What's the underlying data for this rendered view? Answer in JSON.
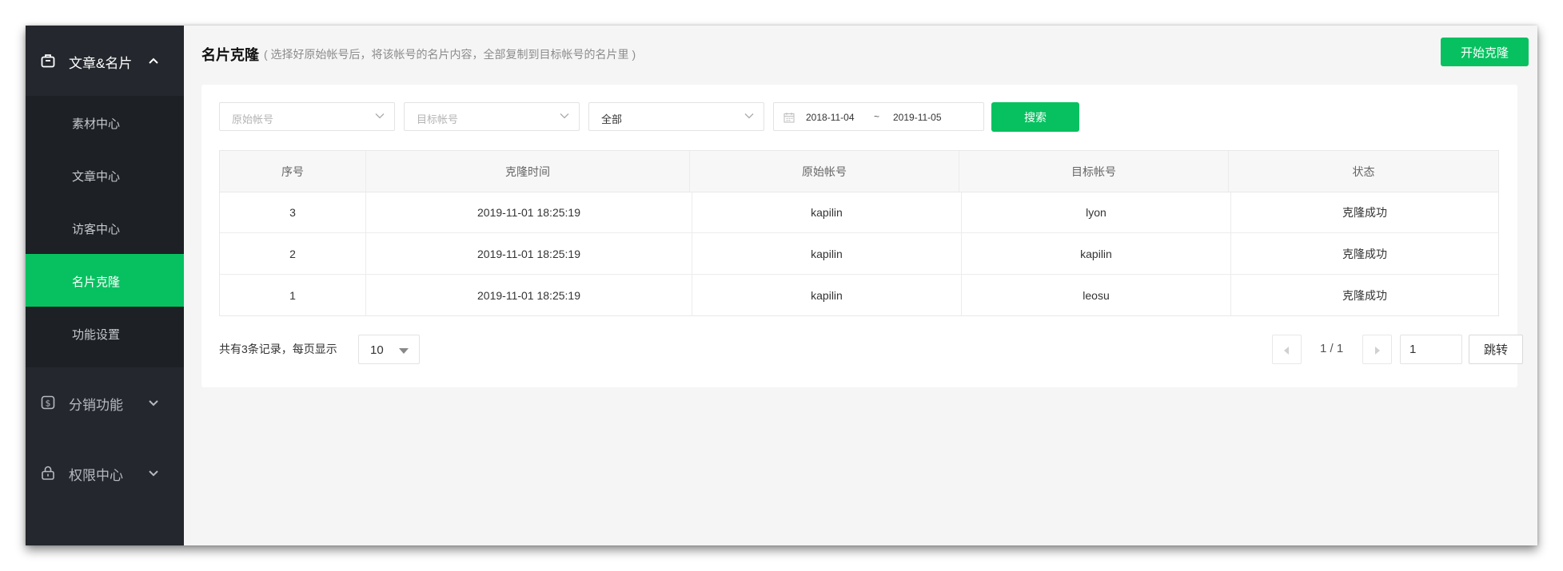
{
  "sidebar": {
    "groups": [
      {
        "label": "文章&名片",
        "icon": "briefcase-icon",
        "expanded": true
      },
      {
        "label": "分销功能",
        "icon": "dollar-icon",
        "expanded": false
      },
      {
        "label": "权限中心",
        "icon": "lock-icon",
        "expanded": false
      }
    ],
    "items": [
      {
        "label": "素材中心"
      },
      {
        "label": "文章中心"
      },
      {
        "label": "访客中心"
      },
      {
        "label": "名片克隆",
        "active": true
      },
      {
        "label": "功能设置"
      }
    ]
  },
  "header": {
    "title": "名片克隆",
    "hint": "( 选择好原始帐号后，将该帐号的名片内容，全部复制到目标帐号的名片里 )",
    "start_button": "开始克隆"
  },
  "filters": {
    "source_placeholder": "原始帐号",
    "target_placeholder": "目标帐号",
    "status_value": "全部",
    "date_start": "2018-11-04",
    "date_sep": "~",
    "date_end": "2019-11-05",
    "search_button": "搜索"
  },
  "table": {
    "headers": [
      "序号",
      "克隆时间",
      "原始帐号",
      "目标帐号",
      "状态"
    ],
    "rows": [
      [
        "3",
        "2019-11-01 18:25:19",
        "kapilin",
        "lyon",
        "克隆成功"
      ],
      [
        "2",
        "2019-11-01 18:25:19",
        "kapilin",
        "kapilin",
        "克隆成功"
      ],
      [
        "1",
        "2019-11-01 18:25:19",
        "kapilin",
        "leosu",
        "克隆成功"
      ]
    ]
  },
  "pagination": {
    "total_text": "共有3条记录，每页显示",
    "page_size": "10",
    "page_info": "1 / 1",
    "jump_value": "1",
    "jump_button": "跳转"
  },
  "colors": {
    "accent": "#07c160",
    "sidebar_bg": "#24272d",
    "submenu_bg": "#1d2025",
    "content_bg": "#f5f5f5"
  }
}
